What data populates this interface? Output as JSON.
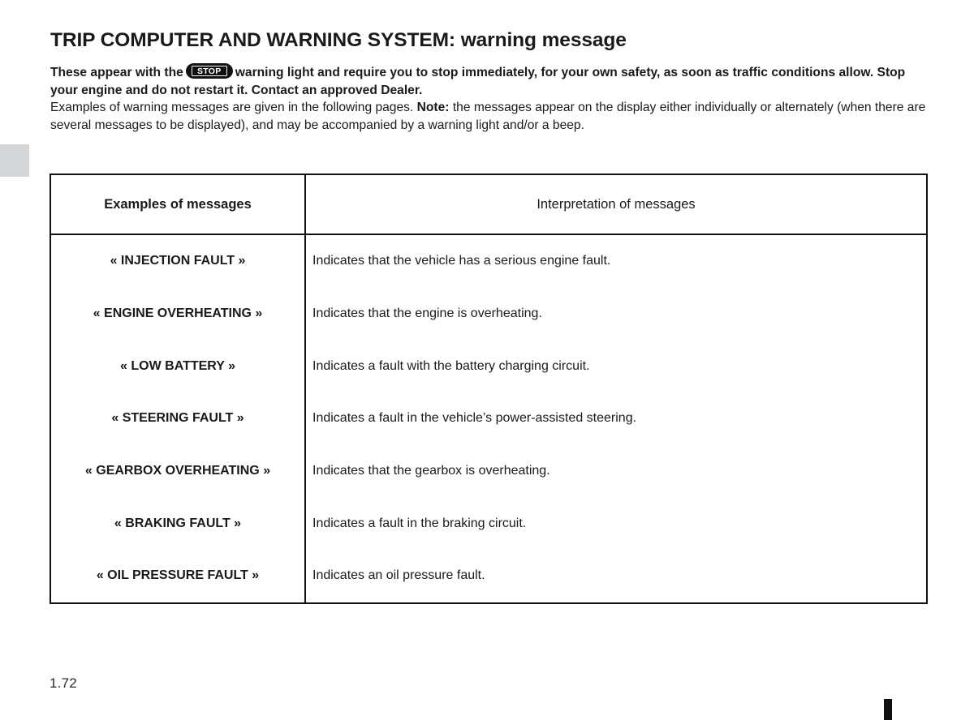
{
  "page": {
    "title_main": "TRIP COMPUTER AND WARNING SYSTEM:",
    "title_sub": "warning message",
    "page_number": "1.72",
    "colors": {
      "text": "#1a1a1a",
      "rule": "#111111",
      "edge_tab": "#d5d6d8",
      "background": "#ffffff"
    }
  },
  "intro": {
    "stop_icon_label": "STOP",
    "lead_before_icon": "These appear with the",
    "lead_after_icon": "warning light and require you to stop immediately, for your own safety, as soon as traffic conditions allow. Stop your engine and do not restart it. Contact an approved Dealer.",
    "note_before": "Examples of warning messages are given in the following pages.",
    "note_label": "Note:",
    "note_after": "the messages appear on the display either individually or alternately (when there are several messages to be displayed), and may be accompanied by a warning light and/or a beep."
  },
  "table": {
    "headers": {
      "col1": "Examples of messages",
      "col2": "Interpretation of messages"
    },
    "rows": [
      {
        "message": "« INJECTION FAULT »",
        "interpretation": "Indicates that the vehicle has a serious engine fault."
      },
      {
        "message": "« ENGINE OVERHEATING »",
        "interpretation": "Indicates that the engine is overheating."
      },
      {
        "message": "« LOW BATTERY »",
        "interpretation": "Indicates a fault with the battery charging circuit."
      },
      {
        "message": "« STEERING FAULT »",
        "interpretation": "Indicates a fault in the vehicle’s power-assisted steering."
      },
      {
        "message": "« GEARBOX OVERHEATING »",
        "interpretation": "Indicates that the gearbox is overheating."
      },
      {
        "message": "« BRAKING FAULT »",
        "interpretation": "Indicates a fault in the braking circuit."
      },
      {
        "message": "« OIL PRESSURE FAULT »",
        "interpretation": "Indicates an oil pressure fault."
      }
    ]
  }
}
